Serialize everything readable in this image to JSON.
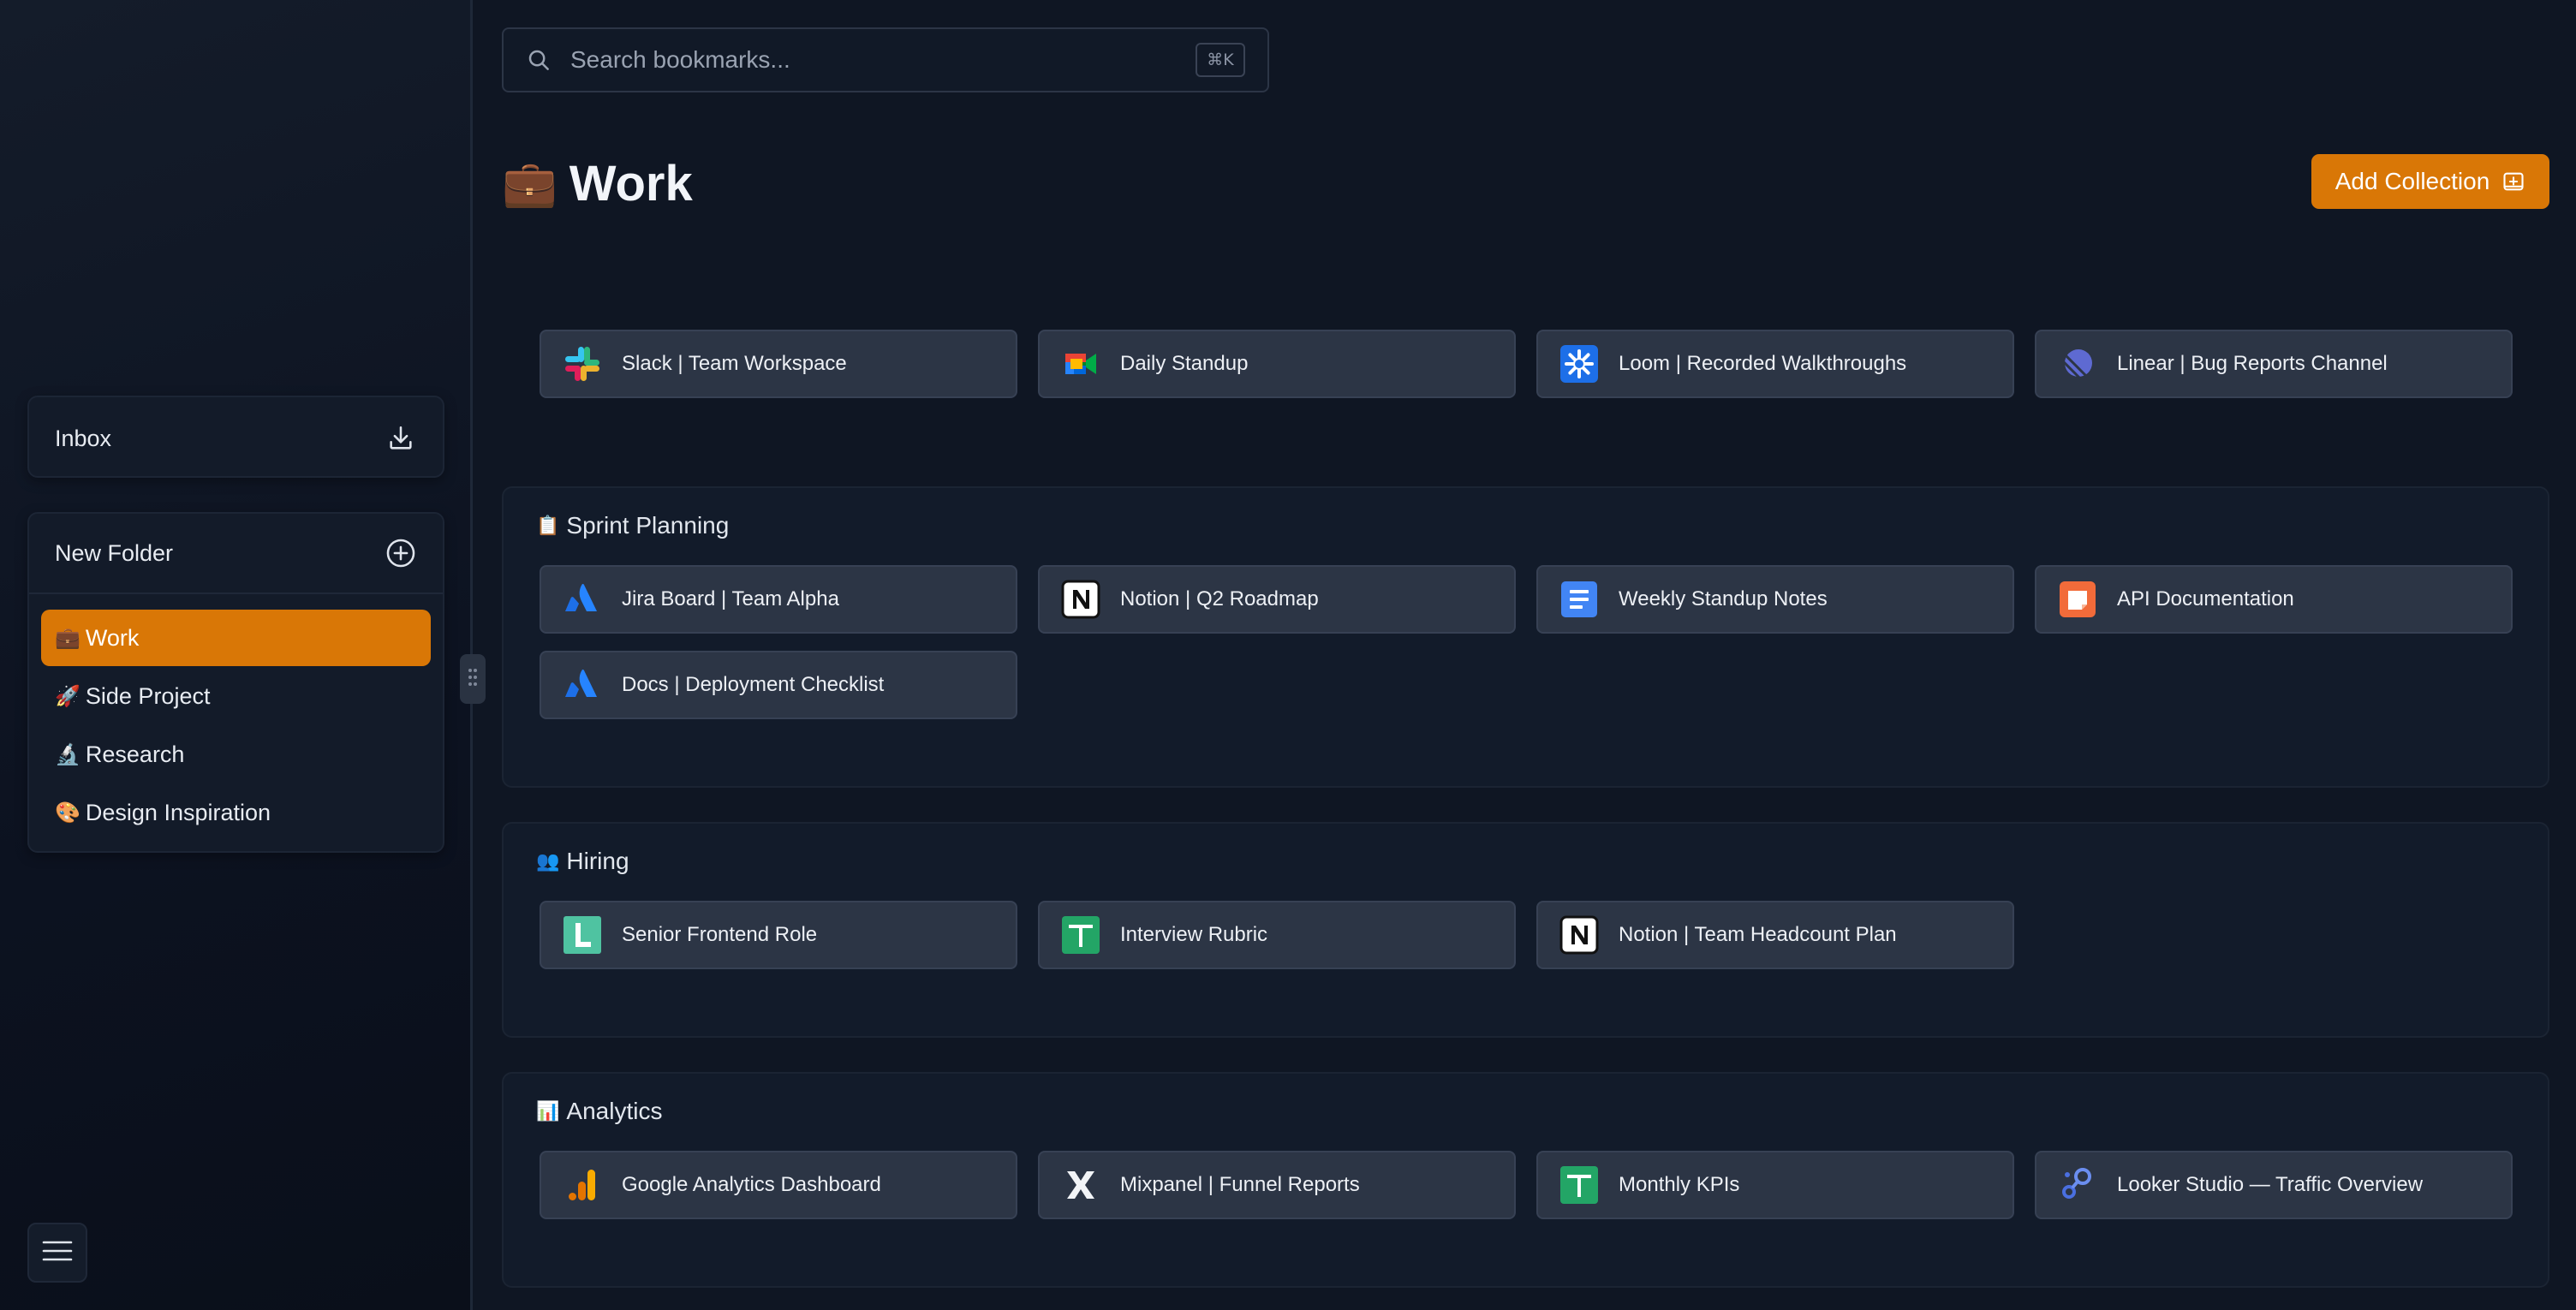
{
  "sidebar": {
    "inbox_label": "Inbox",
    "new_folder_label": "New Folder",
    "folders": [
      {
        "emoji": "💼",
        "label": "Work",
        "active": true
      },
      {
        "emoji": "🚀",
        "label": "Side Project",
        "active": false
      },
      {
        "emoji": "🔬",
        "label": "Research",
        "active": false
      },
      {
        "emoji": "🎨",
        "label": "Design Inspiration",
        "active": false
      }
    ]
  },
  "search": {
    "placeholder": "Search bookmarks...",
    "shortcut": "⌘K"
  },
  "page": {
    "emoji": "💼",
    "title": "Work",
    "add_collection_label": "Add Collection"
  },
  "pinned": [
    {
      "label": "Slack | Team Workspace",
      "icon": "slack-icon"
    },
    {
      "label": "Daily Standup",
      "icon": "google-meet-icon"
    },
    {
      "label": "Loom | Recorded Walkthroughs",
      "icon": "loom-icon"
    },
    {
      "label": "Linear | Bug Reports Channel",
      "icon": "linear-icon"
    }
  ],
  "sections": [
    {
      "emoji": "📋",
      "title": "Sprint Planning",
      "items": [
        {
          "label": "Jira Board | Team Alpha",
          "icon": "atlassian-icon"
        },
        {
          "label": "Notion | Q2 Roadmap",
          "icon": "notion-icon"
        },
        {
          "label": "Weekly Standup Notes",
          "icon": "google-docs-icon"
        },
        {
          "label": "API Documentation",
          "icon": "slides-icon"
        },
        {
          "label": "Docs | Deployment Checklist",
          "icon": "atlassian-icon"
        }
      ]
    },
    {
      "emoji": "👥",
      "title": "Hiring",
      "items": [
        {
          "label": "Senior Frontend Role",
          "icon": "lever-icon"
        },
        {
          "label": "Interview Rubric",
          "icon": "google-sheets-icon"
        },
        {
          "label": "Notion | Team Headcount Plan",
          "icon": "notion-icon"
        }
      ]
    },
    {
      "emoji": "📊",
      "title": "Analytics",
      "items": [
        {
          "label": "Google Analytics Dashboard",
          "icon": "google-analytics-icon"
        },
        {
          "label": "Mixpanel | Funnel Reports",
          "icon": "mixpanel-icon"
        },
        {
          "label": "Monthly KPIs",
          "icon": "google-sheets-icon"
        },
        {
          "label": "Looker Studio — Traffic Overview",
          "icon": "looker-studio-icon"
        }
      ]
    }
  ],
  "colors": {
    "accent": "#d97706",
    "background": "#0f1623",
    "card": "#2c3545"
  }
}
